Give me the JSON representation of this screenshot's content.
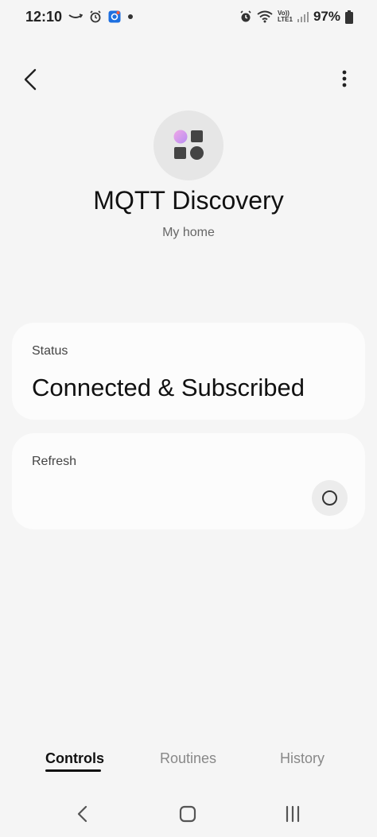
{
  "status_bar": {
    "time": "12:10",
    "battery": "97%",
    "left_icons": [
      "amazon-smile-icon",
      "alarm-icon",
      "app-notification-icon",
      "dot-icon"
    ],
    "right_icons": [
      "alarm-icon",
      "wifi-icon",
      "volte-lte-icon",
      "signal-icon",
      "battery-icon"
    ],
    "volte_label": "Vo))",
    "lte_label": "LTE1"
  },
  "header": {
    "back_icon": "chevron-left-icon",
    "more_icon": "more-vertical-icon"
  },
  "device": {
    "title": "MQTT Discovery",
    "subtitle": "My home",
    "icon": "device-shapes-icon"
  },
  "cards": {
    "status": {
      "label": "Status",
      "value": "Connected & Subscribed"
    },
    "refresh": {
      "label": "Refresh",
      "button_icon": "circle-icon"
    }
  },
  "tabs": [
    {
      "label": "Controls",
      "active": true
    },
    {
      "label": "Routines",
      "active": false
    },
    {
      "label": "History",
      "active": false
    }
  ],
  "nav": {
    "back": "nav-back-icon",
    "home": "nav-home-icon",
    "recents": "nav-recents-icon"
  },
  "colors": {
    "background": "#f5f5f5",
    "card": "#fcfcfc",
    "accent_pink": "#e3a6f5",
    "accent_purple": "#c58cf0"
  }
}
